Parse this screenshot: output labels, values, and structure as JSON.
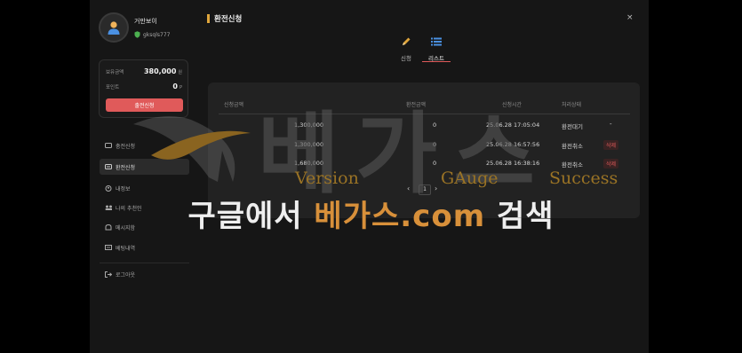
{
  "profile": {
    "name": "거만보이",
    "user_id": "gksqls777"
  },
  "balance": {
    "held_label": "보유금액",
    "held_value": "380,000",
    "held_unit": "원",
    "point_label": "포인트",
    "point_value": "0",
    "point_unit": "P",
    "charge_button": "출전신청"
  },
  "menu": [
    {
      "label": "충전신청",
      "icon": "wallet-icon"
    },
    {
      "label": "환전신청",
      "icon": "exchange-icon"
    },
    {
      "label": "내정보",
      "icon": "user-icon"
    },
    {
      "label": "나의 추천인",
      "icon": "group-icon"
    },
    {
      "label": "메시지함",
      "icon": "message-icon"
    },
    {
      "label": "베팅내역",
      "icon": "list-icon"
    }
  ],
  "logout_label": "로그아웃",
  "header": {
    "title": "환전신청",
    "close": "×"
  },
  "tabs": [
    {
      "label": "신청",
      "icon": "pencil-icon"
    },
    {
      "label": "리스트",
      "icon": "list-icon"
    }
  ],
  "table": {
    "headers": [
      "신청금액",
      "환전금액",
      "신청시간",
      "처리상태"
    ],
    "rows": [
      {
        "amount": "1,300,000",
        "exchanged": "0",
        "time": "25.06.28 17:05:04",
        "status": "환전대기",
        "action": "-"
      },
      {
        "amount": "1,300,000",
        "exchanged": "0",
        "time": "25.06.28 16:57:56",
        "status": "환전취소",
        "action": "삭제"
      },
      {
        "amount": "1,680,000",
        "exchanged": "0",
        "time": "25.06.28 16:38:16",
        "status": "환전취소",
        "action": "삭제"
      }
    ]
  },
  "pagination": {
    "prev": "‹",
    "page": "1",
    "next": "›"
  },
  "watermark": {
    "big_text": "베가스",
    "words": [
      "Version",
      "GAuge",
      "Success"
    ],
    "banner_white_1": "구글에서 ",
    "banner_gold": "베가스.com",
    "banner_white_2": " 검색"
  },
  "colors": {
    "accent_red": "#e05a5a",
    "accent_gold": "#e0a63c",
    "background": "#161616"
  }
}
